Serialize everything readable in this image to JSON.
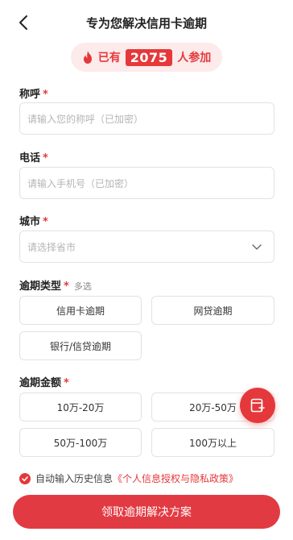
{
  "header": {
    "title": "专为您解决信用卡逾期"
  },
  "banner": {
    "prefix": "已有",
    "count": "2075",
    "suffix": "人参加"
  },
  "fields": {
    "name": {
      "label": "称呼",
      "required": "*",
      "placeholder": "请输入您的称呼（已加密）"
    },
    "phone": {
      "label": "电话",
      "required": "*",
      "placeholder": "请输入手机号（已加密）"
    },
    "city": {
      "label": "城市",
      "required": "*",
      "placeholder": "请选择省市"
    }
  },
  "overdue_type": {
    "label": "逾期类型",
    "required": "*",
    "hint": "多选",
    "options": [
      "信用卡逾期",
      "网贷逾期",
      "银行/信贷逾期"
    ]
  },
  "overdue_amount": {
    "label": "逾期金额",
    "required": "*",
    "options": [
      "10万-20万",
      "20万-50万",
      "50万-100万",
      "100万以上"
    ]
  },
  "agreement": {
    "prefix": "自动输入历史信息",
    "policy": "《个人信息授权与隐私政策》"
  },
  "submit": {
    "label": "领取逾期解决方案"
  },
  "colors": {
    "accent": "#e5383b",
    "banner_bg": "#fdeaea"
  },
  "icons": {
    "back": "chevron-left-icon",
    "fire": "flame-icon",
    "select": "chevron-down-icon",
    "fab": "edit-form-icon",
    "check": "check-icon"
  }
}
